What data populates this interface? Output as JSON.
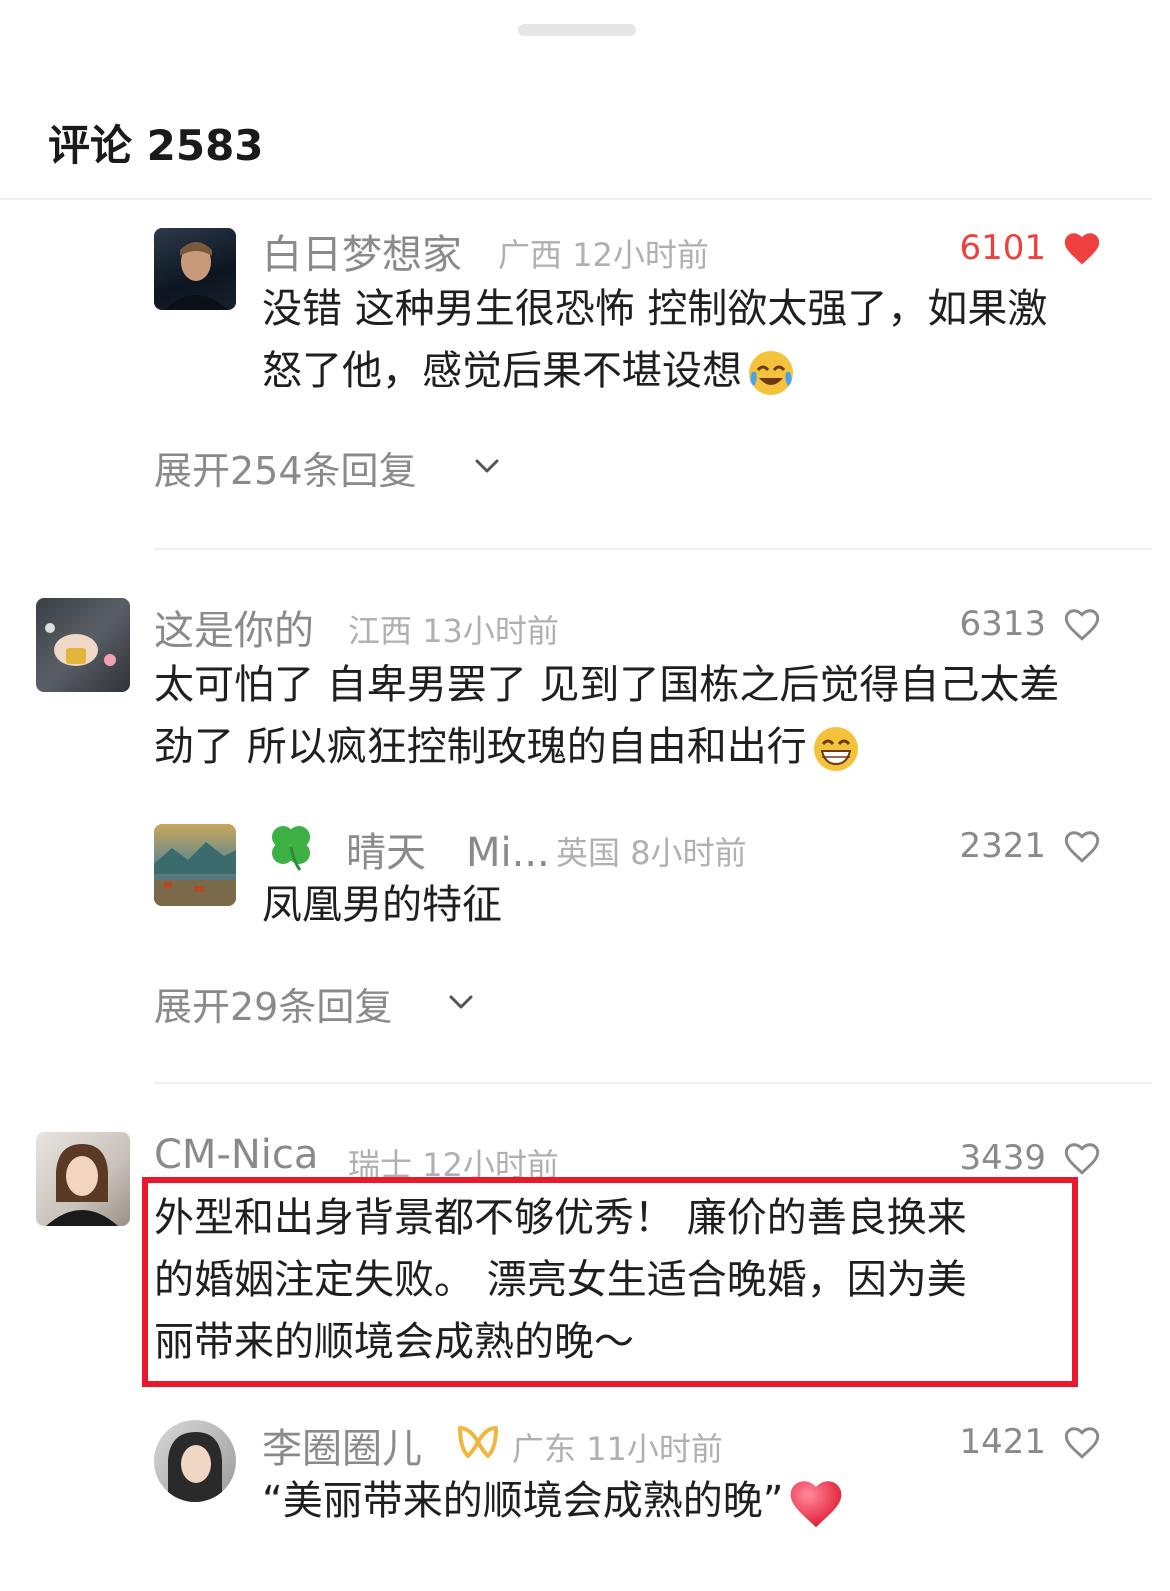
{
  "header": {
    "title": "评论 2583"
  },
  "comments": [
    {
      "username": "白日梦想家",
      "location": "广西",
      "time": "12小时前",
      "likes": "6101",
      "liked": true,
      "text": "没错 这种男生很恐怖 控制欲太强了，如果激怒了他，感觉后果不堪设想",
      "emoji": "laughing-crying-emoji",
      "expand_label": "展开254条回复"
    },
    {
      "username": "这是你的",
      "location": "江西",
      "time": "13小时前",
      "likes": "6313",
      "liked": false,
      "text": "太可怕了 自卑男罢了 见到了国栋之后觉得自己太差劲了 所以疯狂控制玫瑰的自由和出行",
      "emoji": "grinning-emoji",
      "reply": {
        "badge_icon": "four-leaf-clover-icon",
        "username": "晴天　Mi...",
        "location": "英国",
        "time": "8小时前",
        "likes": "2321",
        "liked": false,
        "text": "凤凰男的特征"
      },
      "expand_label": "展开29条回复"
    },
    {
      "username": "CM-Nica",
      "location": "瑞士",
      "time": "12小时前",
      "likes": "3439",
      "liked": false,
      "text_lines": [
        "外型和出身背景都不够优秀！ 廉价的善良换来",
        "的婚姻注定失败。 漂亮女生适合晚婚，因为美",
        "丽带来的顺境会成熟的晚～"
      ],
      "reply": {
        "badge_icon": "gold-badge-icon",
        "username": "李圈圈儿",
        "location": "广东",
        "time": "11小时前",
        "likes": "1421",
        "liked": false,
        "text": "“美丽带来的顺境会成熟的晚”",
        "emoji": "red-heart-emoji"
      }
    }
  ],
  "colors": {
    "accent_red": "#ef4040",
    "highlight_box": "#e8192c"
  }
}
